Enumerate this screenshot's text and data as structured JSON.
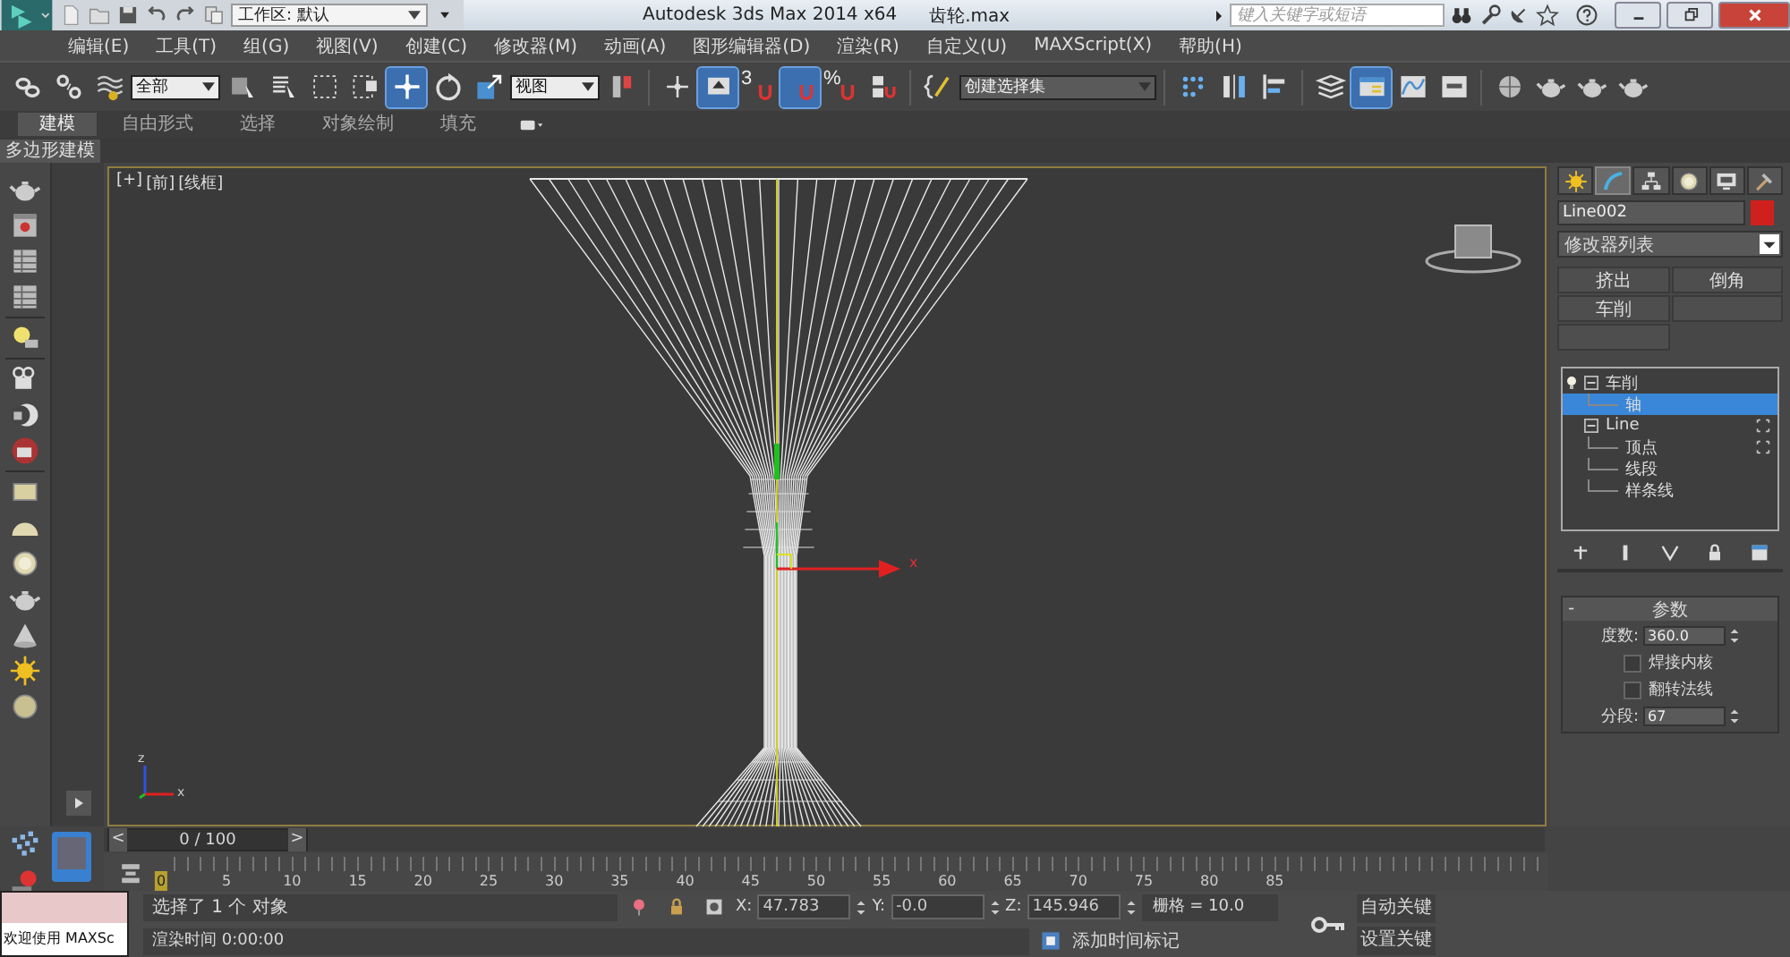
{
  "title_bar": {
    "workspace": "工作区: 默认",
    "app_title": "Autodesk 3ds Max  2014 x64",
    "file_name": "齿轮.max",
    "search": {
      "placeholder": "键入关键字或短语"
    }
  },
  "menu": [
    "编辑(E)",
    "工具(T)",
    "组(G)",
    "视图(V)",
    "创建(C)",
    "修改器(M)",
    "动画(A)",
    "图形编辑器(D)",
    "渲染(R)",
    "自定义(U)",
    "MAXScript(X)",
    "帮助(H)"
  ],
  "main_toolbar": {
    "selection_filter": "全部",
    "reference_coordinate": "视图",
    "named_selection": "创建选择集",
    "snap_label": "3",
    "percent_label": "%",
    "tools": [
      {
        "active": false
      },
      {
        "active": false
      },
      {
        "active": false
      },
      {
        "active": false
      },
      {
        "active": false
      },
      {
        "active": false
      },
      {
        "active": false
      },
      {
        "active": true
      },
      {
        "active": false
      },
      {
        "active": false
      },
      {
        "active": false
      },
      {
        "active": false
      },
      {
        "active": true
      },
      {
        "active": false
      },
      {
        "active": true
      },
      {
        "active": false
      },
      {
        "active": false
      },
      {
        "active": false
      },
      {
        "active": false
      },
      {
        "active": false
      },
      {
        "active": false
      },
      {
        "active": false
      },
      {
        "active": true
      },
      {
        "active": false
      },
      {
        "active": false
      },
      {
        "active": false
      },
      {
        "active": false
      },
      {
        "active": false
      },
      {
        "active": false
      }
    ]
  },
  "ribbon": {
    "tabs": [
      {
        "label": "建模",
        "selected": true
      },
      {
        "label": "自由形式",
        "selected": false
      },
      {
        "label": "选择",
        "selected": false
      },
      {
        "label": "对象绘制",
        "selected": false
      },
      {
        "label": "填充",
        "selected": false
      }
    ],
    "panel": "多边形建模"
  },
  "viewport": {
    "labels": [
      "[+]",
      "[前]",
      "[线框]"
    ],
    "gizmo_label": "x",
    "tripod_labels": [
      "z",
      "x"
    ]
  },
  "command_panel": {
    "tabs": [
      {
        "selected": false
      },
      {
        "selected": true
      },
      {
        "selected": false
      },
      {
        "selected": false
      },
      {
        "selected": false
      },
      {
        "selected": false
      }
    ],
    "object_name": "Line002",
    "modifier_list": "修改器列表",
    "modifier_buttons": [
      "挤出",
      "倒角",
      "车削"
    ],
    "stack": [
      {
        "label": "车削",
        "selected": false,
        "expanded": true,
        "enabled": true,
        "children": [
          {
            "label": "轴",
            "selected": true
          }
        ]
      },
      {
        "label": "Line",
        "selected": false,
        "expanded": true,
        "children": [
          {
            "label": "顶点",
            "selected": false
          },
          {
            "label": "线段",
            "selected": false
          },
          {
            "label": "样条线",
            "selected": false
          }
        ]
      }
    ],
    "parameters": {
      "toggle": "-",
      "title": "参数",
      "degrees": {
        "label": "度数:",
        "value": "360.0"
      },
      "weld_core": {
        "label": "焊接内核",
        "checked": false
      },
      "flip_normals": {
        "label": "翻转法线",
        "checked": false
      },
      "segments": {
        "label": "分段:",
        "value": "67"
      }
    }
  },
  "timeline": {
    "position": "0 / 100",
    "level": 0,
    "prev": "<",
    "next": ">",
    "ticks": [
      {
        "label": "0",
        "current": true
      },
      {
        "label": "5",
        "current": false
      },
      {
        "label": "10",
        "current": false
      },
      {
        "label": "15",
        "current": false
      },
      {
        "label": "20",
        "current": false
      },
      {
        "label": "25",
        "current": false
      },
      {
        "label": "30",
        "current": false
      },
      {
        "label": "35",
        "current": false
      },
      {
        "label": "40",
        "current": false
      },
      {
        "label": "45",
        "current": false
      },
      {
        "label": "50",
        "current": false
      },
      {
        "label": "55",
        "current": false
      },
      {
        "label": "60",
        "current": false
      },
      {
        "label": "65",
        "current": false
      },
      {
        "label": "70",
        "current": false
      },
      {
        "label": "75",
        "current": false
      },
      {
        "label": "80",
        "current": false
      },
      {
        "label": "85",
        "current": false
      }
    ]
  },
  "status_bar": {
    "welcome": "欢迎使用 MAXSc",
    "selection": "选择了 1 个 对象",
    "render_time": "渲染时间 0:00:00",
    "x": {
      "label": "X:",
      "value": "47.783"
    },
    "y": {
      "label": "Y:",
      "value": "-0.0"
    },
    "z": {
      "label": "Z:",
      "value": "145.946"
    },
    "grid": "栅格 = 10.0",
    "add_time_tag": "添加时间标记",
    "auto_key": "自动关键",
    "set_key": "设置关键"
  }
}
